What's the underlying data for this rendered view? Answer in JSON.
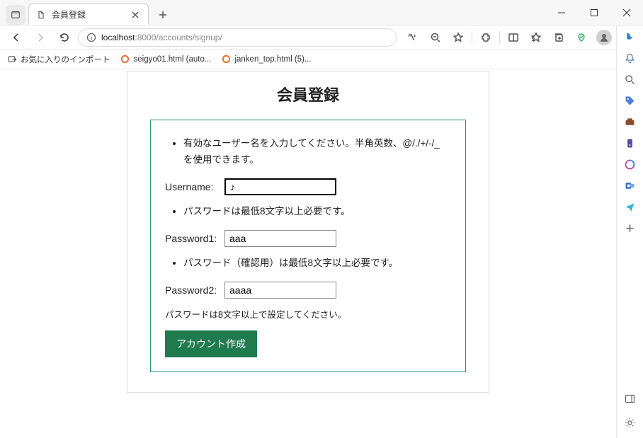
{
  "browser": {
    "tab_title": "会員登録",
    "url_prefix": "localhost",
    "url_rest": ":8000/accounts/signup/"
  },
  "bookmarks": {
    "import": "お気に入りのインポート",
    "b1": "seigyo01.html (auto...",
    "b2": "janken_top.html (5)..."
  },
  "page": {
    "heading": "会員登録",
    "err_username": "有効なユーザー名を入力してください。半角英数、@/./+/-/_ を使用できます。",
    "err_pw1": "パスワードは最低8文字以上必要です。",
    "err_pw2": "パスワード（確認用）は最低8文字以上必要です。",
    "label_username": "Username:",
    "label_pw1": "Password1:",
    "label_pw2": "Password2:",
    "val_username": "♪",
    "val_pw1": "aaa",
    "val_pw2": "aaaa",
    "help_text": "パスワードは8文字以上で設定してください。",
    "submit": "アカウント作成"
  }
}
